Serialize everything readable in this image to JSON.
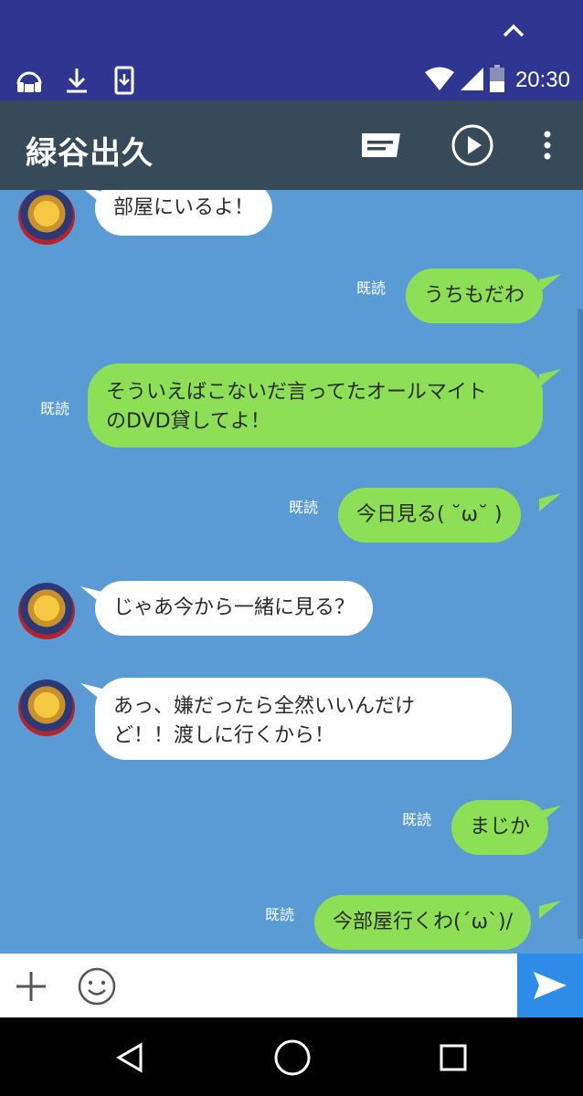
{
  "status_bar": {
    "time": "20:30",
    "icons": [
      "expand-chevron-icon",
      "headphones-icon",
      "download-icon",
      "phone-download-icon",
      "wifi-icon",
      "signal-icon",
      "battery-icon"
    ]
  },
  "app_bar": {
    "title": "緑谷出久",
    "actions": [
      "message-icon",
      "play-circle-icon",
      "more-vert-icon"
    ]
  },
  "messages": [
    {
      "side": "in",
      "text": "部屋にいるよ！"
    },
    {
      "side": "out",
      "read": "既読",
      "text": "うちもだわ"
    },
    {
      "side": "out",
      "read": "既読",
      "lines": [
        "そういえばこないだ言ってたオールマイト",
        "のDVD貸してよ！"
      ]
    },
    {
      "side": "out",
      "read": "既読",
      "text": "今日見る( ˘ω˘ )"
    },
    {
      "side": "in",
      "text": "じゃあ今から一緒に見る？"
    },
    {
      "side": "in",
      "lines": [
        "あっ、嫌だったら全然いいんだけ",
        "ど！！渡しに行くから！"
      ]
    },
    {
      "side": "out",
      "read": "既読",
      "text": "まじか"
    },
    {
      "side": "out",
      "read": "既読",
      "text": "今部屋行くわ(´ω`)/"
    }
  ],
  "input": {
    "placeholder": ""
  },
  "colors": {
    "status_bar": "#2E3692",
    "app_bar": "#364A5A",
    "chat_bg": "#5B9BD5",
    "bubble_out": "#8DE055",
    "bubble_in": "#FFFFFF",
    "send": "#2E8BE8"
  }
}
